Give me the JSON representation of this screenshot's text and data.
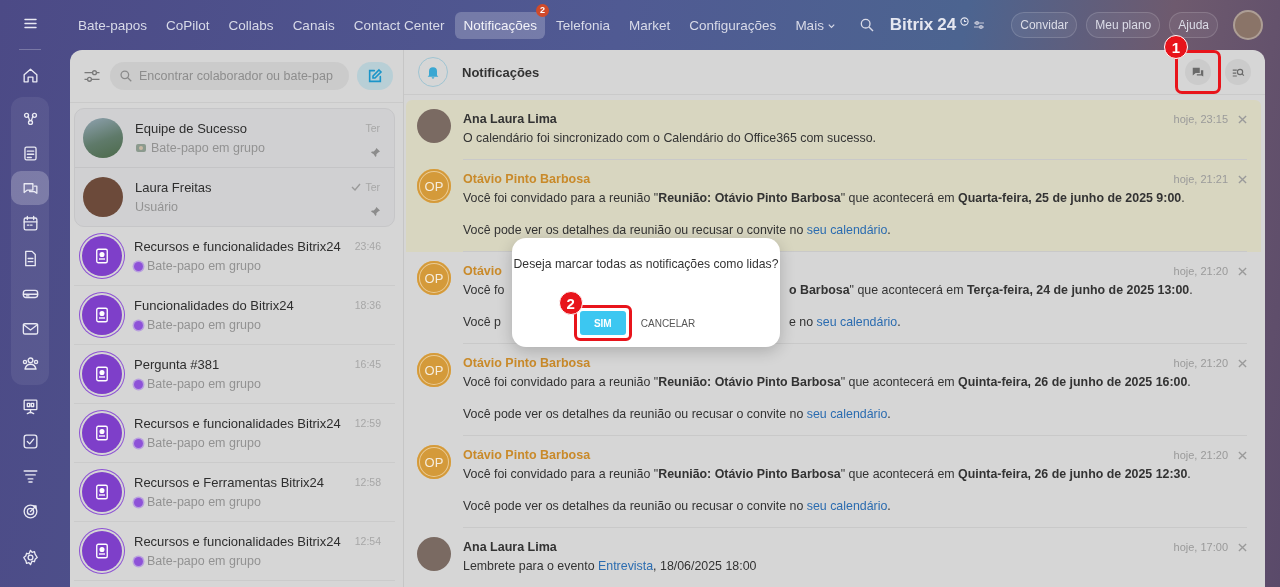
{
  "rail": {
    "items": [
      {
        "kind": "menu",
        "selected": false
      },
      {
        "kind": "home",
        "selected": false
      },
      {
        "kind": "flow",
        "selected": false
      },
      {
        "kind": "feed",
        "selected": false
      },
      {
        "kind": "chat",
        "selected": true
      },
      {
        "kind": "calendar",
        "selected": false
      },
      {
        "kind": "document",
        "selected": false
      },
      {
        "kind": "drive",
        "selected": false
      },
      {
        "kind": "mail",
        "selected": false
      },
      {
        "kind": "people",
        "selected": false
      },
      {
        "kind": "board",
        "selected": false
      },
      {
        "kind": "task",
        "selected": false
      },
      {
        "kind": "funnel",
        "selected": false
      },
      {
        "kind": "target",
        "selected": false
      },
      {
        "kind": "settings",
        "selected": false
      }
    ]
  },
  "nav": {
    "tabs": [
      {
        "label": "Bate-papos",
        "selected": false
      },
      {
        "label": "CoPilot",
        "selected": false
      },
      {
        "label": "Collabs",
        "selected": false
      },
      {
        "label": "Canais",
        "selected": false
      },
      {
        "label": "Contact Center",
        "selected": false
      },
      {
        "label": "Notificações",
        "selected": true,
        "badge": "2"
      },
      {
        "label": "Telefonia",
        "selected": false
      },
      {
        "label": "Market",
        "selected": false
      },
      {
        "label": "Configurações",
        "selected": false
      }
    ],
    "more": "Mais",
    "logo": "Bitrix",
    "logo_number": "24",
    "buttons": [
      "Convidar",
      "Meu plano",
      "Ajuda"
    ]
  },
  "chat_list": {
    "search": {
      "placeholder": "Encontrar colaborador ou bate-pap"
    },
    "chats": [
      {
        "name": "Equipe de Sucesso",
        "subtitle": "Bate-papo em grupo",
        "time": "Ter",
        "kind": "photo",
        "pinned": true,
        "read": false
      },
      {
        "name": "Laura Freitas",
        "subtitle": "Usuário",
        "time": "Ter",
        "kind": "person",
        "pinned": true,
        "read": true
      },
      {
        "name": "Recursos e funcionalidades Bitrix24",
        "subtitle": "Bate-papo em grupo",
        "time": "23:46",
        "kind": "group",
        "pinned": false,
        "read": false
      },
      {
        "name": "Funcionalidades do Bitrix24",
        "subtitle": "Bate-papo em grupo",
        "time": "18:36",
        "kind": "group",
        "pinned": false,
        "read": false
      },
      {
        "name": "Pergunta #381",
        "subtitle": "Bate-papo em grupo",
        "time": "16:45",
        "kind": "group",
        "pinned": false,
        "read": false
      },
      {
        "name": "Recursos e funcionalidades Bitrix24",
        "subtitle": "Bate-papo em grupo",
        "time": "12:59",
        "kind": "group",
        "pinned": false,
        "read": false
      },
      {
        "name": "Recursos e Ferramentas Bitrix24",
        "subtitle": "Bate-papo em grupo",
        "time": "12:58",
        "kind": "group",
        "pinned": false,
        "read": false
      },
      {
        "name": "Recursos e funcionalidades Bitrix24",
        "subtitle": "Bate-papo em grupo",
        "time": "12:54",
        "kind": "group",
        "pinned": false,
        "read": false
      }
    ]
  },
  "notifications": {
    "title": "Notificações",
    "items": [
      {
        "author": "Ana Laura Lima",
        "kind": "person",
        "time": "hoje, 23:15",
        "unread": true,
        "lines": [
          {
            "text": "O calendário foi sincronizado com o Calendário do Office365 com sucesso."
          }
        ]
      },
      {
        "author": "Otávio Pinto Barbosa",
        "kind": "initials",
        "initials": "OP",
        "time": "hoje, 21:21",
        "unread": true,
        "lines": [
          {
            "text": "Você foi convidado para a reunião \"**Reunião: Otávio Pinto Barbosa**\" que acontecerá em **Quarta-feira, 25 de junho de 2025 9:00**."
          },
          {
            "text": "Você pode ver os detalhes da reunião ou recusar o convite no ",
            "link": "seu calendário",
            "after": "."
          }
        ]
      },
      {
        "author": "Otávio",
        "kind": "initials",
        "initials": "OP",
        "time": "hoje, 21:20",
        "unread": false,
        "lines": [
          {
            "left": "Você fo",
            "text": "**o Barbosa**\" que acontecerá em **Terça-feira, 24 de junho de 2025 13:00**."
          },
          {
            "left": "Você p",
            "text": "e no ",
            "link": "seu calendário",
            "after": "."
          }
        ]
      },
      {
        "author": "Otávio Pinto Barbosa",
        "kind": "initials",
        "initials": "OP",
        "time": "hoje, 21:20",
        "unread": false,
        "lines": [
          {
            "text": "Você foi convidado para a reunião \"**Reunião: Otávio Pinto Barbosa**\" que acontecerá em **Quinta-feira, 26 de junho de 2025 16:00**."
          },
          {
            "text": "Você pode ver os detalhes da reunião ou recusar o convite no ",
            "link": "seu calendário",
            "after": "."
          }
        ]
      },
      {
        "author": "Otávio Pinto Barbosa",
        "kind": "initials",
        "initials": "OP",
        "time": "hoje, 21:20",
        "unread": false,
        "lines": [
          {
            "text": "Você foi convidado para a reunião \"**Reunião: Otávio Pinto Barbosa**\" que acontecerá em **Quinta-feira, 26 de junho de 2025 12:30**."
          },
          {
            "text": "Você pode ver os detalhes da reunião ou recusar o convite no ",
            "link": "seu calendário",
            "after": "."
          }
        ]
      },
      {
        "author": "Ana Laura Lima",
        "kind": "person",
        "time": "hoje, 17:00",
        "unread": false,
        "lines": [
          {
            "text": "Lembrete para o evento ",
            "link": "Entrevista",
            "after": ", 18/06/2025 18:00"
          }
        ]
      }
    ]
  },
  "dialog": {
    "message": "Deseja marcar todas as notificações como lidas?",
    "confirm": "SIM",
    "cancel": "CANCELAR"
  },
  "callouts": [
    {
      "number": "1"
    },
    {
      "number": "2"
    }
  ]
}
